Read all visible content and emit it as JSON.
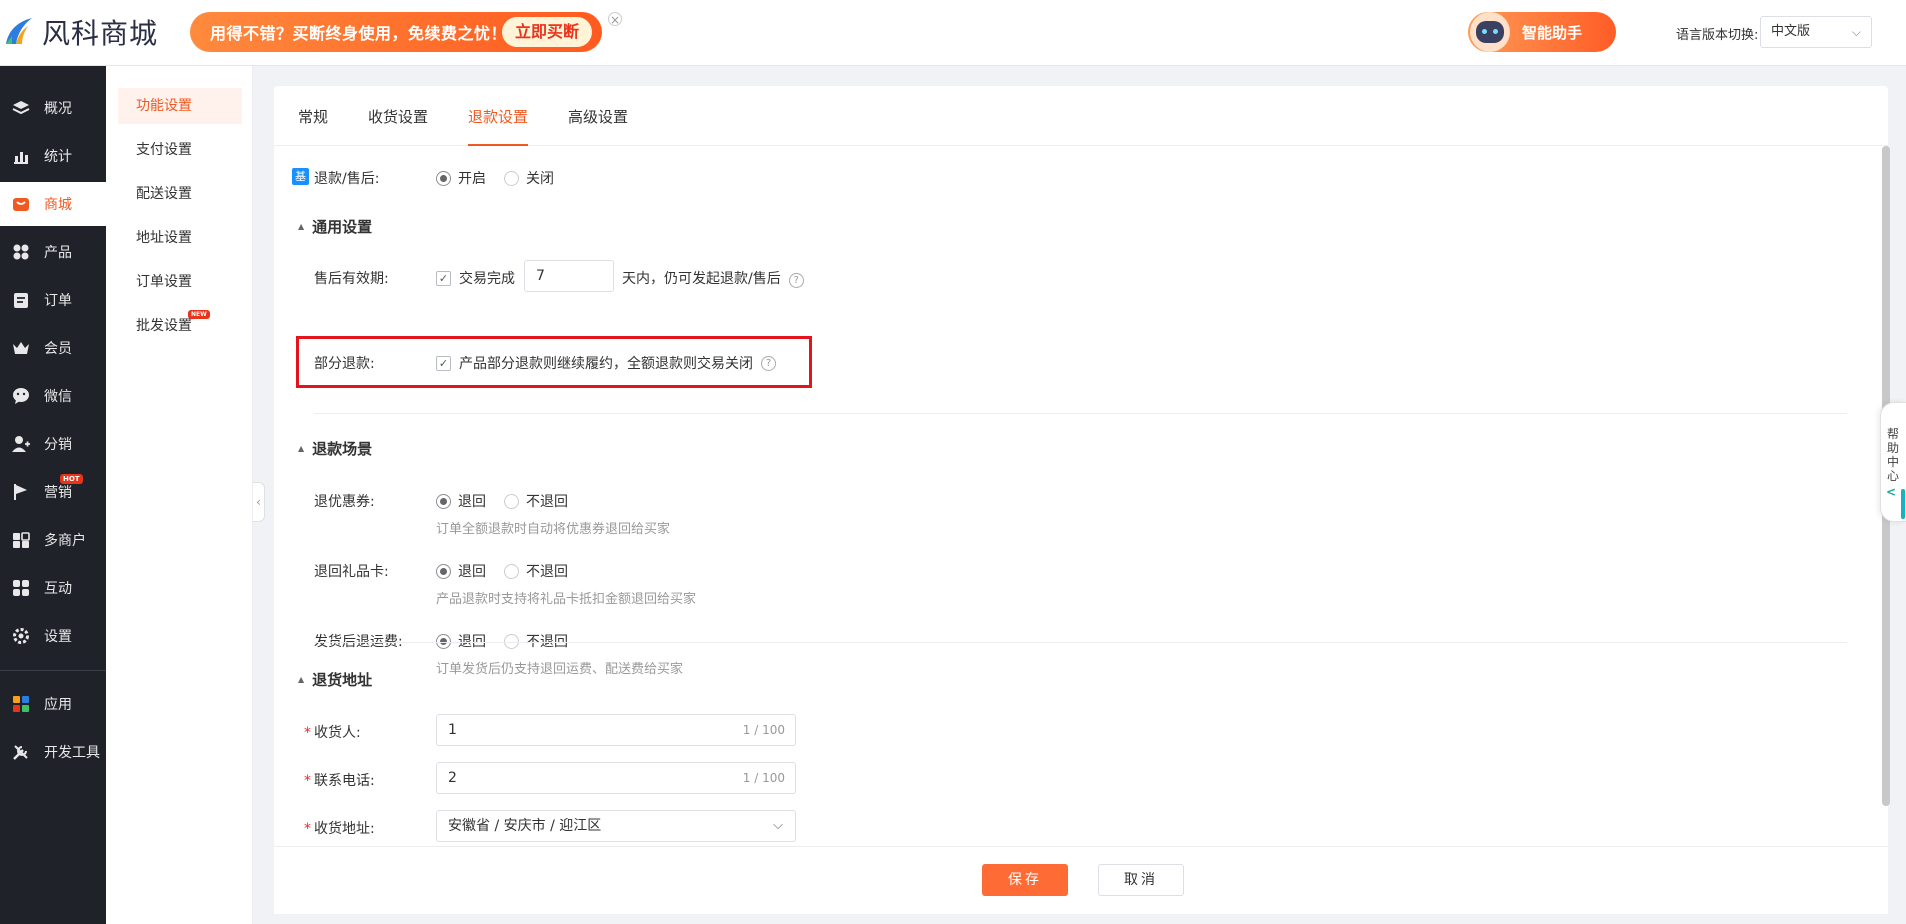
{
  "topbar": {
    "logo_text": "风科商城",
    "promo_text": "用得不错？买断终身使用，免续费之忧！",
    "promo_button": "立即买断",
    "promo_close": "×",
    "assistant_label": "智能助手",
    "lang_label": "语言版本切换:",
    "lang_value": "中文版"
  },
  "sidebar": {
    "items": [
      {
        "label": "概况",
        "icon": "layers-icon"
      },
      {
        "label": "统计",
        "icon": "chart-icon"
      },
      {
        "label": "商城",
        "icon": "shop-icon"
      },
      {
        "label": "产品",
        "icon": "grid-icon"
      },
      {
        "label": "订单",
        "icon": "order-icon"
      },
      {
        "label": "会员",
        "icon": "crown-icon"
      },
      {
        "label": "微信",
        "icon": "wechat-icon"
      },
      {
        "label": "分销",
        "icon": "users-icon"
      },
      {
        "label": "营销",
        "icon": "flag-icon",
        "badge": "HOT"
      },
      {
        "label": "多商户",
        "icon": "store-icon"
      },
      {
        "label": "互动",
        "icon": "interact-icon"
      },
      {
        "label": "设置",
        "icon": "gear-icon"
      },
      {
        "label": "应用",
        "icon": "apps-icon"
      },
      {
        "label": "开发工具",
        "icon": "tools-icon"
      }
    ]
  },
  "subnav": {
    "items": [
      {
        "label": "功能设置"
      },
      {
        "label": "支付设置"
      },
      {
        "label": "配送设置"
      },
      {
        "label": "地址设置"
      },
      {
        "label": "订单设置"
      },
      {
        "label": "批发设置",
        "badge": "NEW"
      }
    ]
  },
  "tabs": [
    "常规",
    "收货设置",
    "退款设置",
    "高级设置"
  ],
  "form": {
    "base_badge": "基",
    "refund": {
      "label": "退款/售后:",
      "on": "开启",
      "off": "关闭"
    },
    "general_section": "通用设置",
    "validity": {
      "label": "售后有效期:",
      "check": "交易完成",
      "value": "7",
      "suffix": "天内，仍可发起退款/售后",
      "help": "?"
    },
    "partial": {
      "label": "部分退款:",
      "check": "产品部分退款则继续履约，全额退款则交易关闭",
      "help": "?"
    },
    "scene_section": "退款场景",
    "coupon": {
      "label": "退优惠券:",
      "yes": "退回",
      "no": "不退回",
      "hint": "订单全额退款时自动将优惠券退回给买家"
    },
    "giftcard": {
      "label": "退回礼品卡:",
      "yes": "退回",
      "no": "不退回",
      "hint": "产品退款时支持将礼品卡抵扣金额退回给买家"
    },
    "shipping": {
      "label": "发货后退运费:",
      "yes": "退回",
      "no": "不退回",
      "hint": "订单发货后仍支持退回运费、配送费给买家"
    },
    "address_section": "退货地址",
    "receiver": {
      "label": "收货人:",
      "value": "1",
      "count": "1 / 100"
    },
    "phone": {
      "label": "联系电话:",
      "value": "2",
      "count": "1 / 100"
    },
    "address": {
      "label": "收货地址:",
      "value": "安徽省 / 安庆市 / 迎江区"
    },
    "required_mark": "*"
  },
  "footer": {
    "save": "保存",
    "cancel": "取消"
  },
  "help_tab": {
    "label": "帮助中心",
    "chevron": "<"
  },
  "colors": {
    "accent": "#f05a22",
    "sidebar_bg": "#1f2228",
    "save_bg": "#ff6b35",
    "highlight": "#e3141c"
  }
}
